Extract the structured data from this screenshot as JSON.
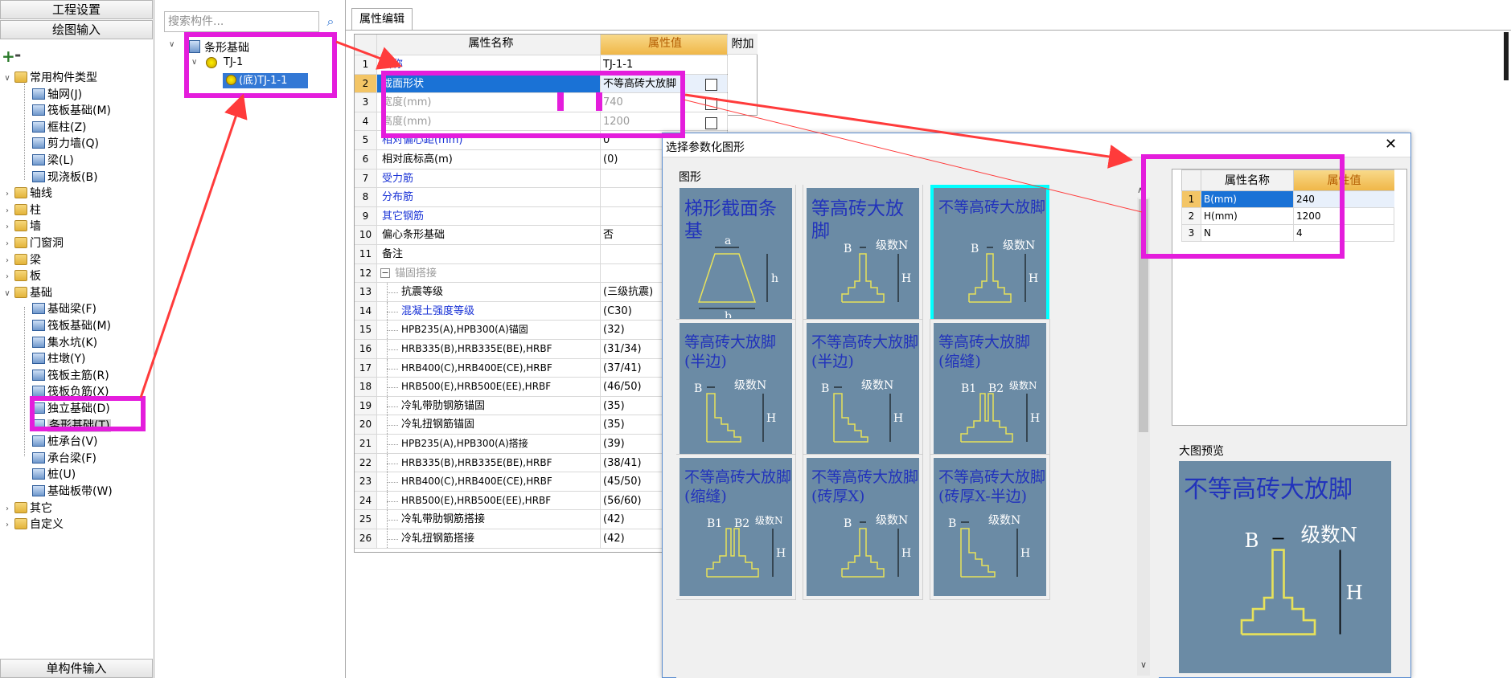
{
  "top_buttons": {
    "project_settings": "工程设置",
    "drawing_input": "绘图输入",
    "single_input": "单构件输入"
  },
  "toolbar": {
    "add": "+",
    "remove": "-"
  },
  "search": {
    "placeholder": "搜索构件..."
  },
  "left_tree": [
    {
      "label": "常用构件类型",
      "type": "folder",
      "expanded": true
    },
    {
      "label": "轴网(J)",
      "type": "comp"
    },
    {
      "label": "筏板基础(M)",
      "type": "comp"
    },
    {
      "label": "框柱(Z)",
      "type": "comp"
    },
    {
      "label": "剪力墙(Q)",
      "type": "comp"
    },
    {
      "label": "梁(L)",
      "type": "comp"
    },
    {
      "label": "现浇板(B)",
      "type": "comp"
    },
    {
      "label": "轴线",
      "type": "folder"
    },
    {
      "label": "柱",
      "type": "folder"
    },
    {
      "label": "墙",
      "type": "folder"
    },
    {
      "label": "门窗洞",
      "type": "folder"
    },
    {
      "label": "梁",
      "type": "folder"
    },
    {
      "label": "板",
      "type": "folder"
    },
    {
      "label": "基础",
      "type": "folder",
      "expanded": true
    },
    {
      "label": "基础梁(F)",
      "type": "comp"
    },
    {
      "label": "筏板基础(M)",
      "type": "comp"
    },
    {
      "label": "集水坑(K)",
      "type": "comp"
    },
    {
      "label": "柱墩(Y)",
      "type": "comp"
    },
    {
      "label": "筏板主筋(R)",
      "type": "comp"
    },
    {
      "label": "筏板负筋(X)",
      "type": "comp"
    },
    {
      "label": "独立基础(D)",
      "type": "comp"
    },
    {
      "label": "条形基础(T)",
      "type": "comp",
      "selected": true
    },
    {
      "label": "桩承台(V)",
      "type": "comp"
    },
    {
      "label": "承台梁(F)",
      "type": "comp"
    },
    {
      "label": "桩(U)",
      "type": "comp"
    },
    {
      "label": "基础板带(W)",
      "type": "comp"
    },
    {
      "label": "其它",
      "type": "folder"
    },
    {
      "label": "自定义",
      "type": "folder"
    }
  ],
  "mid_tree": {
    "root": "条形基础",
    "child": "TJ-1",
    "leaf": "(底)TJ-1-1"
  },
  "tab": "属性编辑",
  "grid": {
    "headers": {
      "num": "",
      "name": "属性名称",
      "value": "属性值",
      "extra": "附加"
    },
    "rows": [
      {
        "n": "1",
        "name": "名称",
        "value": "TJ-1-1",
        "style": "blue",
        "chk": false
      },
      {
        "n": "2",
        "name": "截面形状",
        "value": "不等高砖大放脚",
        "style": "sel",
        "chk": true
      },
      {
        "n": "3",
        "name": "宽度(mm)",
        "value": "740",
        "style": "gray",
        "chk": true
      },
      {
        "n": "4",
        "name": "高度(mm)",
        "value": "1200",
        "style": "gray",
        "chk": true
      },
      {
        "n": "5",
        "name": "相对偏心距(mm)",
        "value": "0",
        "style": "blue",
        "chk": false
      },
      {
        "n": "6",
        "name": "相对底标高(m)",
        "value": "(0)",
        "style": "",
        "chk": false
      },
      {
        "n": "7",
        "name": "受力筋",
        "value": "",
        "style": "blue",
        "chk": false
      },
      {
        "n": "8",
        "name": "分布筋",
        "value": "",
        "style": "blue",
        "chk": false
      },
      {
        "n": "9",
        "name": "其它钢筋",
        "value": "",
        "style": "blue",
        "chk": false
      },
      {
        "n": "10",
        "name": "偏心条形基础",
        "value": "否",
        "style": "",
        "chk": false
      },
      {
        "n": "11",
        "name": "备注",
        "value": "",
        "style": "",
        "chk": false
      },
      {
        "n": "12",
        "name": "锚固搭接",
        "value": "",
        "style": "group",
        "chk": false
      },
      {
        "n": "13",
        "name": "抗震等级",
        "value": "(三级抗震)",
        "style": "sub",
        "chk": false
      },
      {
        "n": "14",
        "name": "混凝土强度等级",
        "value": "(C30)",
        "style": "subblue",
        "chk": false
      },
      {
        "n": "15",
        "name": "HPB235(A),HPB300(A)锚固",
        "value": "(32)",
        "style": "sub",
        "chk": false
      },
      {
        "n": "16",
        "name": "HRB335(B),HRB335E(BE),HRBF",
        "value": "(31/34)",
        "style": "sub",
        "chk": false
      },
      {
        "n": "17",
        "name": "HRB400(C),HRB400E(CE),HRBF",
        "value": "(37/41)",
        "style": "sub",
        "chk": false
      },
      {
        "n": "18",
        "name": "HRB500(E),HRB500E(EE),HRBF",
        "value": "(46/50)",
        "style": "sub",
        "chk": false
      },
      {
        "n": "19",
        "name": "冷轧带肋钢筋锚固",
        "value": "(35)",
        "style": "sub",
        "chk": false
      },
      {
        "n": "20",
        "name": "冷轧扭钢筋锚固",
        "value": "(35)",
        "style": "sub",
        "chk": false
      },
      {
        "n": "21",
        "name": "HPB235(A),HPB300(A)搭接",
        "value": "(39)",
        "style": "sub",
        "chk": false
      },
      {
        "n": "22",
        "name": "HRB335(B),HRB335E(BE),HRBF",
        "value": "(38/41)",
        "style": "sub",
        "chk": false
      },
      {
        "n": "23",
        "name": "HRB400(C),HRB400E(CE),HRBF",
        "value": "(45/50)",
        "style": "sub",
        "chk": false
      },
      {
        "n": "24",
        "name": "HRB500(E),HRB500E(EE),HRBF",
        "value": "(56/60)",
        "style": "sub",
        "chk": false
      },
      {
        "n": "25",
        "name": "冷轧带肋钢筋搭接",
        "value": "(42)",
        "style": "sub",
        "chk": false
      },
      {
        "n": "26",
        "name": "冷轧扭钢筋搭接",
        "value": "(42)",
        "style": "sub",
        "chk": false
      }
    ]
  },
  "dialog": {
    "title": "选择参数化图形",
    "close": "✕",
    "section_label": "图形",
    "tiles": [
      {
        "title": "梯形截面条基",
        "kind": "trap",
        "labels": [
          "a",
          "h",
          "b"
        ]
      },
      {
        "title": "等高砖大放脚",
        "kind": "step",
        "labels": [
          "B",
          "级数N",
          "H"
        ]
      },
      {
        "title": "不等高砖大放脚",
        "kind": "step",
        "labels": [
          "B",
          "级数N",
          "H"
        ],
        "selected": true
      },
      {
        "title": "等高砖大放脚(半边)",
        "kind": "half",
        "labels": [
          "B",
          "级数N",
          "H"
        ]
      },
      {
        "title": "不等高砖大放脚(半边)",
        "kind": "half",
        "labels": [
          "B",
          "级数N",
          "H"
        ]
      },
      {
        "title": "等高砖大放脚(缩缝)",
        "kind": "slot",
        "labels": [
          "B1",
          "B2",
          "级数N",
          "H"
        ]
      },
      {
        "title": "不等高砖大放脚(缩缝)",
        "kind": "slot",
        "labels": [
          "B1",
          "B2",
          "级数N",
          "H"
        ]
      },
      {
        "title": "不等高砖大放脚(砖厚X)",
        "kind": "step",
        "labels": [
          "B",
          "级数N",
          "H"
        ]
      },
      {
        "title": "不等高砖大放脚(砖厚X-半边)",
        "kind": "half",
        "labels": [
          "B",
          "级数N",
          "H"
        ]
      }
    ],
    "param_grid": {
      "headers": {
        "name": "属性名称",
        "value": "属性值"
      },
      "rows": [
        {
          "n": "1",
          "name": "B(mm)",
          "value": "240"
        },
        {
          "n": "2",
          "name": "H(mm)",
          "value": "1200"
        },
        {
          "n": "3",
          "name": "N",
          "value": "4"
        }
      ]
    },
    "preview_label": "大图预览",
    "preview": {
      "title": "不等高砖大放脚",
      "labels": [
        "B",
        "级数N",
        "H"
      ]
    }
  },
  "colors": {
    "highlight": "#e41ddc",
    "arrow": "#ff3b3b",
    "tile_bg": "#6b8ba5",
    "tile_title": "#2233bb",
    "figure_line": "#e8e25a",
    "selected_border": "#00ffff",
    "value_header": "#f3c566"
  }
}
